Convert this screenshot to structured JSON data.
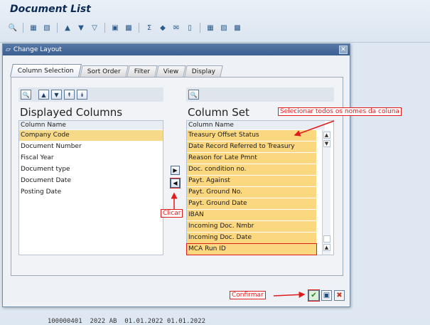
{
  "app": {
    "title": "Document List"
  },
  "dialog": {
    "title": "Change Layout",
    "tabs": [
      "Column Selection",
      "Sort Order",
      "Filter",
      "View",
      "Display"
    ],
    "left": {
      "heading": "Displayed Columns",
      "column_header": "Column Name",
      "items": [
        "Company Code",
        "Document Number",
        "Fiscal Year",
        "Document type",
        "Document Date",
        "Posting Date"
      ]
    },
    "right": {
      "heading": "Column Set",
      "column_header": "Column Name",
      "items": [
        "Treasury Offset Status",
        "Date Record Referred to Treasury",
        "Reason for Late Pmnt",
        "Doc. condition no.",
        "Payt. Against",
        "Payt. Ground No.",
        "Payt. Ground Date",
        "IBAN",
        "Incoming Doc. Nmbr",
        "Incoming Doc. Date",
        "MCA Run ID"
      ]
    }
  },
  "annotations": {
    "select_all": "Selecionar todos os nomes da coluna",
    "click": "Clicar",
    "confirm": "Confirmar"
  },
  "background_rows": [
    {
      "doc": "100000401",
      "year": "2022",
      "type": "AB",
      "doc_date": "01.01.2022",
      "post_date": "01.01.2022"
    }
  ]
}
